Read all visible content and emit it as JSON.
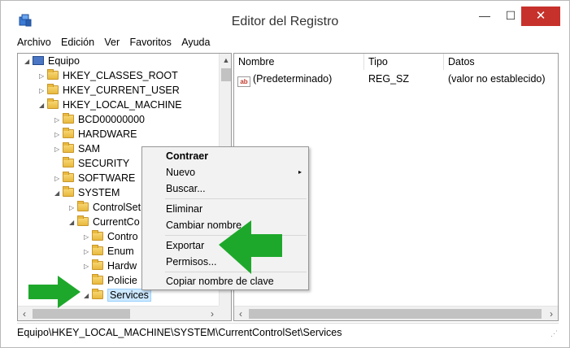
{
  "window": {
    "title": "Editor del Registro",
    "minimize": "—",
    "maximize": "☐",
    "close": "✕",
    "close_color": "#c7312b"
  },
  "menu": [
    "Archivo",
    "Edición",
    "Ver",
    "Favoritos",
    "Ayuda"
  ],
  "tree": {
    "items": [
      {
        "label": "Equipo",
        "expander": "◢",
        "icon": "computer-icon"
      },
      {
        "label": "HKEY_CLASSES_ROOT",
        "expander": "▷",
        "icon": "folder-icon"
      },
      {
        "label": "HKEY_CURRENT_USER",
        "expander": "▷",
        "icon": "folder-icon"
      },
      {
        "label": "HKEY_LOCAL_MACHINE",
        "expander": "◢",
        "icon": "folder-icon"
      },
      {
        "label": "BCD00000000",
        "expander": "▷",
        "icon": "folder-icon"
      },
      {
        "label": "HARDWARE",
        "expander": "▷",
        "icon": "folder-icon"
      },
      {
        "label": "SAM",
        "expander": "▷",
        "icon": "folder-icon"
      },
      {
        "label": "SECURITY",
        "expander": "",
        "icon": "folder-icon"
      },
      {
        "label": "SOFTWARE",
        "expander": "▷",
        "icon": "folder-icon"
      },
      {
        "label": "SYSTEM",
        "expander": "◢",
        "icon": "folder-icon"
      },
      {
        "label": "ControlSet",
        "expander": "▷",
        "icon": "folder-icon"
      },
      {
        "label": "CurrentCo",
        "expander": "◢",
        "icon": "folder-icon"
      },
      {
        "label": "Contro",
        "expander": "▷",
        "icon": "folder-icon"
      },
      {
        "label": "Enum",
        "expander": "▷",
        "icon": "folder-icon"
      },
      {
        "label": "Hardw",
        "expander": "▷",
        "icon": "folder-icon"
      },
      {
        "label": "Policie",
        "expander": "",
        "icon": "folder-icon"
      },
      {
        "label": "Services",
        "expander": "◢",
        "icon": "folder-icon",
        "selected": true
      }
    ]
  },
  "values": {
    "columns": [
      "Nombre",
      "Tipo",
      "Datos"
    ],
    "rows": [
      {
        "icon": "string-value-icon",
        "icon_text": "ab",
        "name": "(Predeterminado)",
        "type": "REG_SZ",
        "data": "(valor no establecido)"
      }
    ]
  },
  "context_menu": {
    "items": [
      {
        "label": "Contraer",
        "bold": true
      },
      {
        "label": "Nuevo",
        "submenu": "▸"
      },
      {
        "label": "Buscar..."
      },
      {
        "label": "Eliminar"
      },
      {
        "label": "Cambiar nombre"
      },
      {
        "label": "Exportar"
      },
      {
        "label": "Permisos..."
      },
      {
        "label": "Copiar nombre de clave"
      }
    ]
  },
  "status": {
    "path": "Equipo\\HKEY_LOCAL_MACHINE\\SYSTEM\\CurrentControlSet\\Services"
  },
  "annotations": {
    "arrow_color": "#1ea82b"
  }
}
